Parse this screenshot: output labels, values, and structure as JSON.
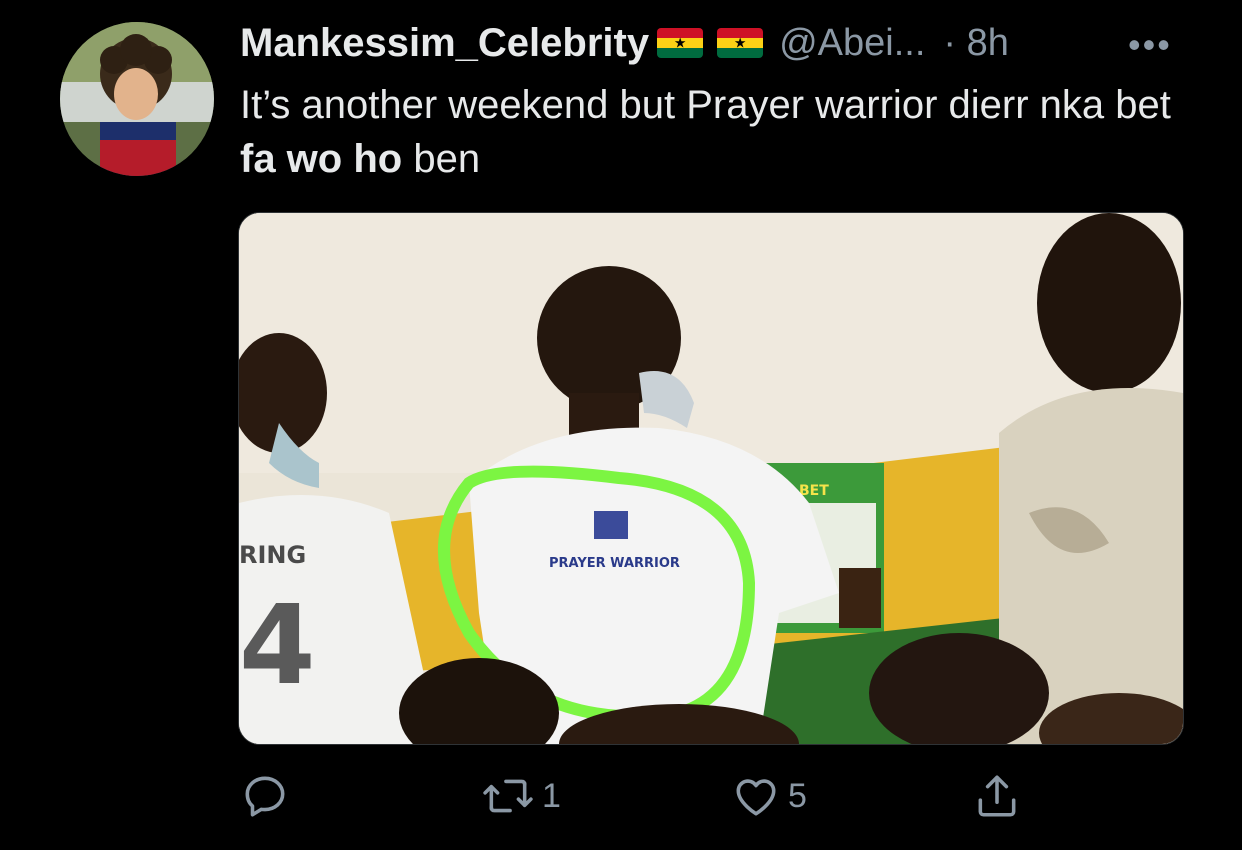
{
  "tweet": {
    "author_name": "Mankessim_Celebrity",
    "flags": [
      "ghana-flag",
      "ghana-flag"
    ],
    "handle": "@Abei...",
    "time": "· 8h",
    "more": "•••",
    "text_parts": {
      "p1": "It’s another weekend but Prayer warrior dierr nka bet ",
      "bold": "fa wo ho",
      "p2": " ben"
    }
  },
  "media": {
    "shirt_left_text": "RING",
    "shirt_left_number": "4",
    "shirt_center_text": "PRAYER WARRIOR",
    "counter_sign": "BET",
    "highlight_color": "#7cf542"
  },
  "actions": {
    "reply": {
      "icon": "reply-icon",
      "count": ""
    },
    "retweet": {
      "icon": "retweet-icon",
      "count": "1"
    },
    "like": {
      "icon": "heart-icon",
      "count": "5"
    },
    "share": {
      "icon": "share-icon",
      "count": ""
    }
  },
  "colors": {
    "background": "#000000",
    "text_primary": "#e7e9ea",
    "text_secondary": "#8b98a5"
  }
}
